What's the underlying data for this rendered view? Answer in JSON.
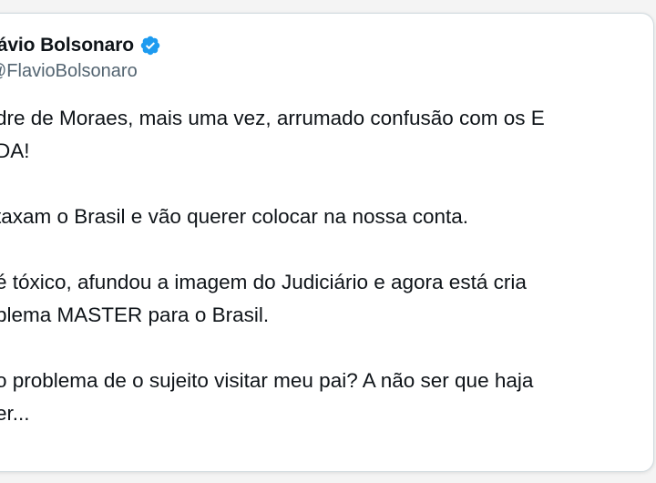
{
  "tweet": {
    "author": {
      "display_name": "lávio Bolsonaro",
      "handle": "@FlavioBolsonaro",
      "verified_icon": "verified-badge-icon",
      "verified_color": "#1d9bf0"
    },
    "lines": [
      "dre de Moraes, mais uma vez, arrumado confusão com os E",
      "DA!",
      "",
      "taxam o Brasil e vão querer colocar na nossa conta.",
      "",
      " é tóxico, afundou a imagem do Judiciário  e agora está cria",
      "blema MASTER para o Brasil.",
      "",
      "o problema de o sujeito visitar meu pai? A não ser que haja",
      "er..."
    ]
  }
}
